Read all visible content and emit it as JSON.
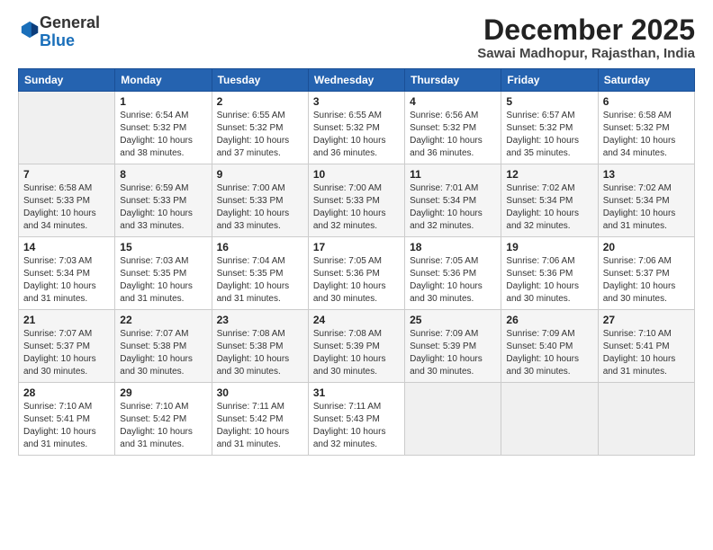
{
  "header": {
    "logo_general": "General",
    "logo_blue": "Blue",
    "month_title": "December 2025",
    "location": "Sawai Madhopur, Rajasthan, India"
  },
  "days_header": [
    "Sunday",
    "Monday",
    "Tuesday",
    "Wednesday",
    "Thursday",
    "Friday",
    "Saturday"
  ],
  "weeks": [
    [
      {
        "day": "",
        "info": ""
      },
      {
        "day": "1",
        "info": "Sunrise: 6:54 AM\nSunset: 5:32 PM\nDaylight: 10 hours\nand 38 minutes."
      },
      {
        "day": "2",
        "info": "Sunrise: 6:55 AM\nSunset: 5:32 PM\nDaylight: 10 hours\nand 37 minutes."
      },
      {
        "day": "3",
        "info": "Sunrise: 6:55 AM\nSunset: 5:32 PM\nDaylight: 10 hours\nand 36 minutes."
      },
      {
        "day": "4",
        "info": "Sunrise: 6:56 AM\nSunset: 5:32 PM\nDaylight: 10 hours\nand 36 minutes."
      },
      {
        "day": "5",
        "info": "Sunrise: 6:57 AM\nSunset: 5:32 PM\nDaylight: 10 hours\nand 35 minutes."
      },
      {
        "day": "6",
        "info": "Sunrise: 6:58 AM\nSunset: 5:32 PM\nDaylight: 10 hours\nand 34 minutes."
      }
    ],
    [
      {
        "day": "7",
        "info": "Sunrise: 6:58 AM\nSunset: 5:33 PM\nDaylight: 10 hours\nand 34 minutes."
      },
      {
        "day": "8",
        "info": "Sunrise: 6:59 AM\nSunset: 5:33 PM\nDaylight: 10 hours\nand 33 minutes."
      },
      {
        "day": "9",
        "info": "Sunrise: 7:00 AM\nSunset: 5:33 PM\nDaylight: 10 hours\nand 33 minutes."
      },
      {
        "day": "10",
        "info": "Sunrise: 7:00 AM\nSunset: 5:33 PM\nDaylight: 10 hours\nand 32 minutes."
      },
      {
        "day": "11",
        "info": "Sunrise: 7:01 AM\nSunset: 5:34 PM\nDaylight: 10 hours\nand 32 minutes."
      },
      {
        "day": "12",
        "info": "Sunrise: 7:02 AM\nSunset: 5:34 PM\nDaylight: 10 hours\nand 32 minutes."
      },
      {
        "day": "13",
        "info": "Sunrise: 7:02 AM\nSunset: 5:34 PM\nDaylight: 10 hours\nand 31 minutes."
      }
    ],
    [
      {
        "day": "14",
        "info": "Sunrise: 7:03 AM\nSunset: 5:34 PM\nDaylight: 10 hours\nand 31 minutes."
      },
      {
        "day": "15",
        "info": "Sunrise: 7:03 AM\nSunset: 5:35 PM\nDaylight: 10 hours\nand 31 minutes."
      },
      {
        "day": "16",
        "info": "Sunrise: 7:04 AM\nSunset: 5:35 PM\nDaylight: 10 hours\nand 31 minutes."
      },
      {
        "day": "17",
        "info": "Sunrise: 7:05 AM\nSunset: 5:36 PM\nDaylight: 10 hours\nand 30 minutes."
      },
      {
        "day": "18",
        "info": "Sunrise: 7:05 AM\nSunset: 5:36 PM\nDaylight: 10 hours\nand 30 minutes."
      },
      {
        "day": "19",
        "info": "Sunrise: 7:06 AM\nSunset: 5:36 PM\nDaylight: 10 hours\nand 30 minutes."
      },
      {
        "day": "20",
        "info": "Sunrise: 7:06 AM\nSunset: 5:37 PM\nDaylight: 10 hours\nand 30 minutes."
      }
    ],
    [
      {
        "day": "21",
        "info": "Sunrise: 7:07 AM\nSunset: 5:37 PM\nDaylight: 10 hours\nand 30 minutes."
      },
      {
        "day": "22",
        "info": "Sunrise: 7:07 AM\nSunset: 5:38 PM\nDaylight: 10 hours\nand 30 minutes."
      },
      {
        "day": "23",
        "info": "Sunrise: 7:08 AM\nSunset: 5:38 PM\nDaylight: 10 hours\nand 30 minutes."
      },
      {
        "day": "24",
        "info": "Sunrise: 7:08 AM\nSunset: 5:39 PM\nDaylight: 10 hours\nand 30 minutes."
      },
      {
        "day": "25",
        "info": "Sunrise: 7:09 AM\nSunset: 5:39 PM\nDaylight: 10 hours\nand 30 minutes."
      },
      {
        "day": "26",
        "info": "Sunrise: 7:09 AM\nSunset: 5:40 PM\nDaylight: 10 hours\nand 30 minutes."
      },
      {
        "day": "27",
        "info": "Sunrise: 7:10 AM\nSunset: 5:41 PM\nDaylight: 10 hours\nand 31 minutes."
      }
    ],
    [
      {
        "day": "28",
        "info": "Sunrise: 7:10 AM\nSunset: 5:41 PM\nDaylight: 10 hours\nand 31 minutes."
      },
      {
        "day": "29",
        "info": "Sunrise: 7:10 AM\nSunset: 5:42 PM\nDaylight: 10 hours\nand 31 minutes."
      },
      {
        "day": "30",
        "info": "Sunrise: 7:11 AM\nSunset: 5:42 PM\nDaylight: 10 hours\nand 31 minutes."
      },
      {
        "day": "31",
        "info": "Sunrise: 7:11 AM\nSunset: 5:43 PM\nDaylight: 10 hours\nand 32 minutes."
      },
      {
        "day": "",
        "info": ""
      },
      {
        "day": "",
        "info": ""
      },
      {
        "day": "",
        "info": ""
      }
    ]
  ]
}
